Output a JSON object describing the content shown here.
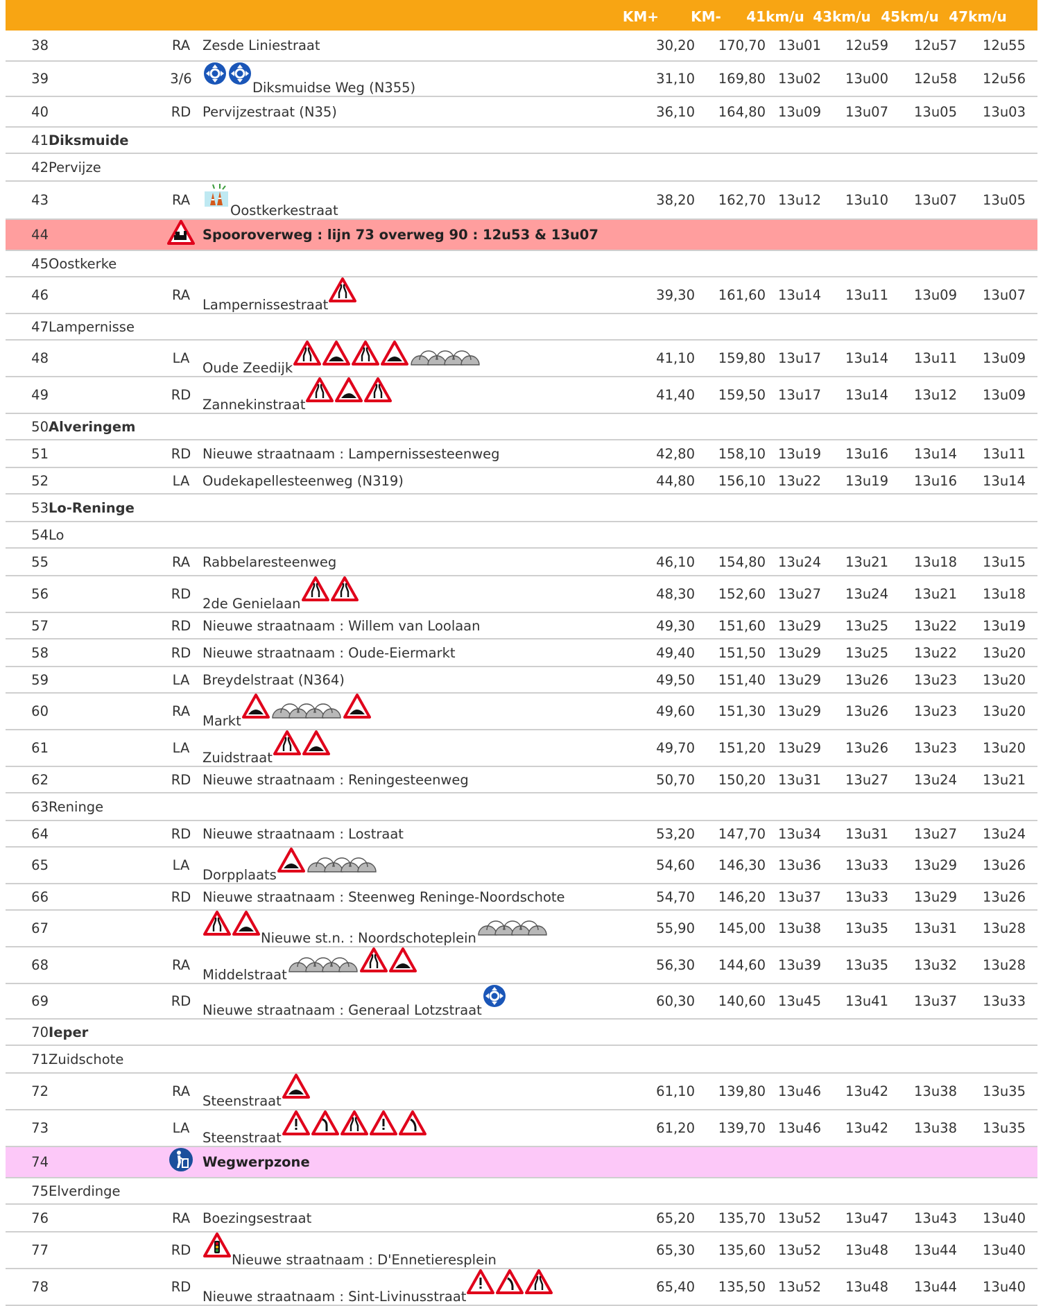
{
  "header": {
    "kmp": "KM+",
    "kmm": "KM-",
    "s41": "41km/u",
    "s43": "43km/u",
    "s45": "45km/u",
    "s47": "47km/u"
  },
  "colors": {
    "header": "#f8a513",
    "railway_row": "#ff9e9e",
    "waste_row": "#fcc8f8",
    "sign_red": "#e0001b",
    "roundabout_blue": "#1a56b8"
  },
  "rows": [
    {
      "nr": "38",
      "dir": "RA",
      "street": "Zesde Liniestraat",
      "kp": "30,20",
      "km": "170,70",
      "t41": "13u01",
      "t43": "12u59",
      "t45": "12u57",
      "t47": "12u55"
    },
    {
      "nr": "39",
      "dir": "3/6",
      "pre": [
        "roundabout-icon",
        "roundabout-icon"
      ],
      "street": "Diksmuidse Weg (N355)",
      "kp": "31,10",
      "km": "169,80",
      "t41": "13u02",
      "t43": "13u00",
      "t45": "12u58",
      "t47": "12u56"
    },
    {
      "nr": "40",
      "dir": "RD",
      "street": "Pervijzestraat (N35)",
      "kp": "36,10",
      "km": "164,80",
      "t41": "13u09",
      "t43": "13u07",
      "t45": "13u05",
      "t47": "13u03"
    },
    {
      "nr": "41",
      "place": "Diksmuide",
      "bold": true
    },
    {
      "nr": "42",
      "place": "Pervijze"
    },
    {
      "nr": "43",
      "dir": "RA",
      "pre": [
        "cones-icon"
      ],
      "street": "Oostkerkestraat",
      "kp": "38,20",
      "km": "162,70",
      "t41": "13u12",
      "t43": "13u10",
      "t45": "13u07",
      "t47": "13u05"
    },
    {
      "nr": "44",
      "kind": "alert",
      "dirIcon": "railway-crossing-icon",
      "street": "Spooroverweg : lijn 73 overweg 90 : 12u53 & 13u07"
    },
    {
      "nr": "45",
      "place": "Oostkerke"
    },
    {
      "nr": "46",
      "dir": "RA",
      "street": "Lampernissestraat",
      "post": [
        "narrowing-icon"
      ],
      "kp": "39,30",
      "km": "161,60",
      "t41": "13u14",
      "t43": "13u11",
      "t45": "13u09",
      "t47": "13u07"
    },
    {
      "nr": "47",
      "place": "Lampernisse"
    },
    {
      "nr": "48",
      "dir": "LA",
      "street": "Oude Zeedijk",
      "post": [
        "narrowing-icon",
        "speed-bump-icon",
        "narrowing-icon",
        "speed-bump-icon",
        "cobblestones-icon"
      ],
      "kp": "41,10",
      "km": "159,80",
      "t41": "13u17",
      "t43": "13u14",
      "t45": "13u11",
      "t47": "13u09"
    },
    {
      "nr": "49",
      "dir": "RD",
      "street": "Zannekinstraat",
      "post": [
        "narrowing-icon",
        "speed-bump-icon",
        "narrowing-icon"
      ],
      "kp": "41,40",
      "km": "159,50",
      "t41": "13u17",
      "t43": "13u14",
      "t45": "13u12",
      "t47": "13u09"
    },
    {
      "nr": "50",
      "place": "Alveringem",
      "bold": true
    },
    {
      "nr": "51",
      "dir": "RD",
      "street": "Nieuwe straatnaam : Lampernissesteenweg",
      "kp": "42,80",
      "km": "158,10",
      "t41": "13u19",
      "t43": "13u16",
      "t45": "13u14",
      "t47": "13u11"
    },
    {
      "nr": "52",
      "dir": "LA",
      "street": "Oudekapellesteenweg (N319)",
      "kp": "44,80",
      "km": "156,10",
      "t41": "13u22",
      "t43": "13u19",
      "t45": "13u16",
      "t47": "13u14"
    },
    {
      "nr": "53",
      "place": "Lo-Reninge",
      "bold": true
    },
    {
      "nr": "54",
      "place": "Lo"
    },
    {
      "nr": "55",
      "dir": "RA",
      "street": "Rabbelaresteenweg",
      "kp": "46,10",
      "km": "154,80",
      "t41": "13u24",
      "t43": "13u21",
      "t45": "13u18",
      "t47": "13u15"
    },
    {
      "nr": "56",
      "dir": "RD",
      "street": "2de Genielaan",
      "post": [
        "narrowing-icon",
        "narrowing-icon"
      ],
      "kp": "48,30",
      "km": "152,60",
      "t41": "13u27",
      "t43": "13u24",
      "t45": "13u21",
      "t47": "13u18"
    },
    {
      "nr": "57",
      "dir": "RD",
      "street": "Nieuwe straatnaam : Willem van Loolaan",
      "kp": "49,30",
      "km": "151,60",
      "t41": "13u29",
      "t43": "13u25",
      "t45": "13u22",
      "t47": "13u19"
    },
    {
      "nr": "58",
      "dir": "RD",
      "street": "Nieuwe straatnaam : Oude-Eiermarkt",
      "kp": "49,40",
      "km": "151,50",
      "t41": "13u29",
      "t43": "13u25",
      "t45": "13u22",
      "t47": "13u20"
    },
    {
      "nr": "59",
      "dir": "LA",
      "street": "Breydelstraat (N364)",
      "kp": "49,50",
      "km": "151,40",
      "t41": "13u29",
      "t43": "13u26",
      "t45": "13u23",
      "t47": "13u20"
    },
    {
      "nr": "60",
      "dir": "RA",
      "street": "Markt",
      "post": [
        "speed-bump-icon",
        "cobblestones-icon",
        "speed-bump-icon"
      ],
      "kp": "49,60",
      "km": "151,30",
      "t41": "13u29",
      "t43": "13u26",
      "t45": "13u23",
      "t47": "13u20"
    },
    {
      "nr": "61",
      "dir": "LA",
      "street": "Zuidstraat",
      "post": [
        "narrowing-icon",
        "speed-bump-icon"
      ],
      "kp": "49,70",
      "km": "151,20",
      "t41": "13u29",
      "t43": "13u26",
      "t45": "13u23",
      "t47": "13u20"
    },
    {
      "nr": "62",
      "dir": "RD",
      "street": "Nieuwe straatnaam : Reningesteenweg",
      "kp": "50,70",
      "km": "150,20",
      "t41": "13u31",
      "t43": "13u27",
      "t45": "13u24",
      "t47": "13u21"
    },
    {
      "nr": "63",
      "place": "Reninge"
    },
    {
      "nr": "64",
      "dir": "RD",
      "street": "Nieuwe straatnaam : Lostraat",
      "kp": "53,20",
      "km": "147,70",
      "t41": "13u34",
      "t43": "13u31",
      "t45": "13u27",
      "t47": "13u24"
    },
    {
      "nr": "65",
      "dir": "LA",
      "street": "Dorpplaats",
      "post": [
        "speed-bump-icon",
        "cobblestones-icon"
      ],
      "kp": "54,60",
      "km": "146,30",
      "t41": "13u36",
      "t43": "13u33",
      "t45": "13u29",
      "t47": "13u26"
    },
    {
      "nr": "66",
      "dir": "RD",
      "street": "Nieuwe straatnaam : Steenweg Reninge-Noordschote",
      "kp": "54,70",
      "km": "146,20",
      "t41": "13u37",
      "t43": "13u33",
      "t45": "13u29",
      "t47": "13u26"
    },
    {
      "nr": "67",
      "dir": "",
      "pre": [
        "narrowing-icon",
        "speed-bump-icon"
      ],
      "street": "Nieuwe st.n. : Noordschoteplein",
      "post": [
        "cobblestones-icon"
      ],
      "kp": "55,90",
      "km": "145,00",
      "t41": "13u38",
      "t43": "13u35",
      "t45": "13u31",
      "t47": "13u28"
    },
    {
      "nr": "68",
      "dir": "RA",
      "street": "Middelstraat",
      "post": [
        "cobblestones-icon",
        "narrowing-icon",
        "speed-bump-icon"
      ],
      "kp": "56,30",
      "km": "144,60",
      "t41": "13u39",
      "t43": "13u35",
      "t45": "13u32",
      "t47": "13u28"
    },
    {
      "nr": "69",
      "dir": "RD",
      "street": "Nieuwe straatnaam : Generaal Lotzstraat",
      "post": [
        "roundabout-icon"
      ],
      "kp": "60,30",
      "km": "140,60",
      "t41": "13u45",
      "t43": "13u41",
      "t45": "13u37",
      "t47": "13u33"
    },
    {
      "nr": "70",
      "place": "Ieper",
      "bold": true
    },
    {
      "nr": "71",
      "place": "Zuidschote"
    },
    {
      "nr": "72",
      "dir": "RA",
      "street": "Steenstraat",
      "post": [
        "speed-bump-icon"
      ],
      "kp": "61,10",
      "km": "139,80",
      "t41": "13u46",
      "t43": "13u42",
      "t45": "13u38",
      "t47": "13u35"
    },
    {
      "nr": "73",
      "dir": "LA",
      "street": "Steenstraat",
      "post": [
        "danger-icon",
        "curve-left-icon",
        "narrowing-icon",
        "danger-icon",
        "curve-right-icon"
      ],
      "kp": "61,20",
      "km": "139,70",
      "t41": "13u46",
      "t43": "13u42",
      "t45": "13u38",
      "t47": "13u35"
    },
    {
      "nr": "74",
      "kind": "pink",
      "dirIcon": "waste-disposal-icon",
      "street": "Wegwerpzone"
    },
    {
      "nr": "75",
      "place": "Elverdinge"
    },
    {
      "nr": "76",
      "dir": "RA",
      "street": "Boezingsestraat",
      "kp": "65,20",
      "km": "135,70",
      "t41": "13u52",
      "t43": "13u47",
      "t45": "13u43",
      "t47": "13u40"
    },
    {
      "nr": "77",
      "dir": "RD",
      "pre": [
        "traffic-light-icon"
      ],
      "street": "Nieuwe straatnaam : D'Ennetieresplein",
      "kp": "65,30",
      "km": "135,60",
      "t41": "13u52",
      "t43": "13u48",
      "t45": "13u44",
      "t47": "13u40"
    },
    {
      "nr": "78",
      "dir": "RD",
      "street": "Nieuwe straatnaam : Sint-Livinusstraat",
      "post": [
        "danger-icon",
        "curve-right-icon",
        "narrowing-icon"
      ],
      "kp": "65,40",
      "km": "135,50",
      "t41": "13u52",
      "t43": "13u48",
      "t45": "13u44",
      "t47": "13u40"
    }
  ]
}
